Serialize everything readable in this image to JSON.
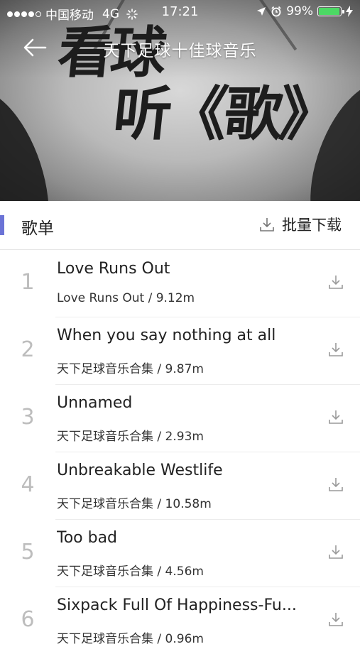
{
  "status_bar": {
    "carrier": "中国移动",
    "network": "4G",
    "time": "17:21",
    "battery": "99%",
    "battery_color": "#4cd964"
  },
  "nav": {
    "back_icon": "arrow-left-icon",
    "title": "天下足球十佳球音乐"
  },
  "cover": {
    "line1": "看球",
    "line2": "听《歌》"
  },
  "section": {
    "title": "歌单",
    "batch_download": "批量下载",
    "accent_color": "#6b73d6"
  },
  "songs": [
    {
      "num": "1",
      "title": "Love Runs Out",
      "meta": "Love Runs Out / 9.12m"
    },
    {
      "num": "2",
      "title": "When you say nothing at all",
      "meta": "天下足球音乐合集 / 9.87m"
    },
    {
      "num": "3",
      "title": "Unnamed",
      "meta": "天下足球音乐合集 / 2.93m"
    },
    {
      "num": "4",
      "title": "Unbreakable Westlife",
      "meta": "天下足球音乐合集 / 10.58m"
    },
    {
      "num": "5",
      "title": "Too bad",
      "meta": "天下足球音乐合集 / 4.56m"
    },
    {
      "num": "6",
      "title": "Sixpack Full Of Happiness-Fu...",
      "meta": "天下足球音乐合集 / 0.96m"
    }
  ]
}
